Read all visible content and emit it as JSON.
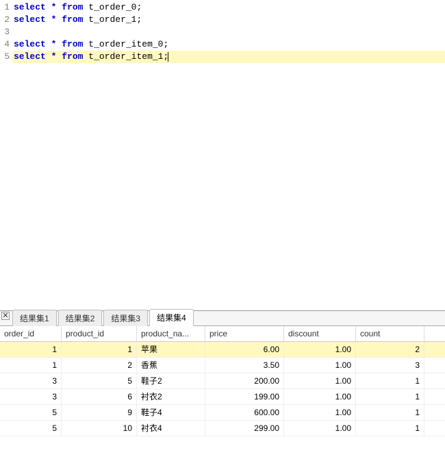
{
  "editor": {
    "lines": [
      {
        "n": "1",
        "tokens": [
          [
            "kw",
            "select"
          ],
          [
            "pt",
            " "
          ],
          [
            "star",
            "*"
          ],
          [
            "pt",
            " "
          ],
          [
            "kw",
            "from"
          ],
          [
            "pt",
            " t_order_0;"
          ]
        ],
        "current": false
      },
      {
        "n": "2",
        "tokens": [
          [
            "kw",
            "select"
          ],
          [
            "pt",
            " "
          ],
          [
            "star",
            "*"
          ],
          [
            "pt",
            " "
          ],
          [
            "kw",
            "from"
          ],
          [
            "pt",
            " t_order_1;"
          ]
        ],
        "current": false
      },
      {
        "n": "3",
        "tokens": [],
        "current": false
      },
      {
        "n": "4",
        "tokens": [
          [
            "kw",
            "select"
          ],
          [
            "pt",
            " "
          ],
          [
            "star",
            "*"
          ],
          [
            "pt",
            " "
          ],
          [
            "kw",
            "from"
          ],
          [
            "pt",
            " t_order_item_0;"
          ]
        ],
        "current": false
      },
      {
        "n": "5",
        "tokens": [
          [
            "kw",
            "select"
          ],
          [
            "pt",
            " "
          ],
          [
            "star",
            "*"
          ],
          [
            "pt",
            " "
          ],
          [
            "kw",
            "from"
          ],
          [
            "pt",
            " t_order_item_1;"
          ]
        ],
        "current": true
      }
    ]
  },
  "results": {
    "close_label": "✕",
    "tabs": [
      {
        "label": "结果集1",
        "active": false
      },
      {
        "label": "结果集2",
        "active": false
      },
      {
        "label": "结果集3",
        "active": false
      },
      {
        "label": "结果集4",
        "active": true
      }
    ],
    "columns": [
      "order_id",
      "product_id",
      "product_na...",
      "price",
      "discount",
      "count"
    ],
    "rows": [
      {
        "sel": true,
        "cells": [
          "1",
          "1",
          "苹果",
          "6.00",
          "1.00",
          "2"
        ]
      },
      {
        "sel": false,
        "cells": [
          "1",
          "2",
          "香蕉",
          "3.50",
          "1.00",
          "3"
        ]
      },
      {
        "sel": false,
        "cells": [
          "3",
          "5",
          "鞋子2",
          "200.00",
          "1.00",
          "1"
        ]
      },
      {
        "sel": false,
        "cells": [
          "3",
          "6",
          "衬衣2",
          "199.00",
          "1.00",
          "1"
        ]
      },
      {
        "sel": false,
        "cells": [
          "5",
          "9",
          "鞋子4",
          "600.00",
          "1.00",
          "1"
        ]
      },
      {
        "sel": false,
        "cells": [
          "5",
          "10",
          "衬衣4",
          "299.00",
          "1.00",
          "1"
        ]
      }
    ]
  }
}
